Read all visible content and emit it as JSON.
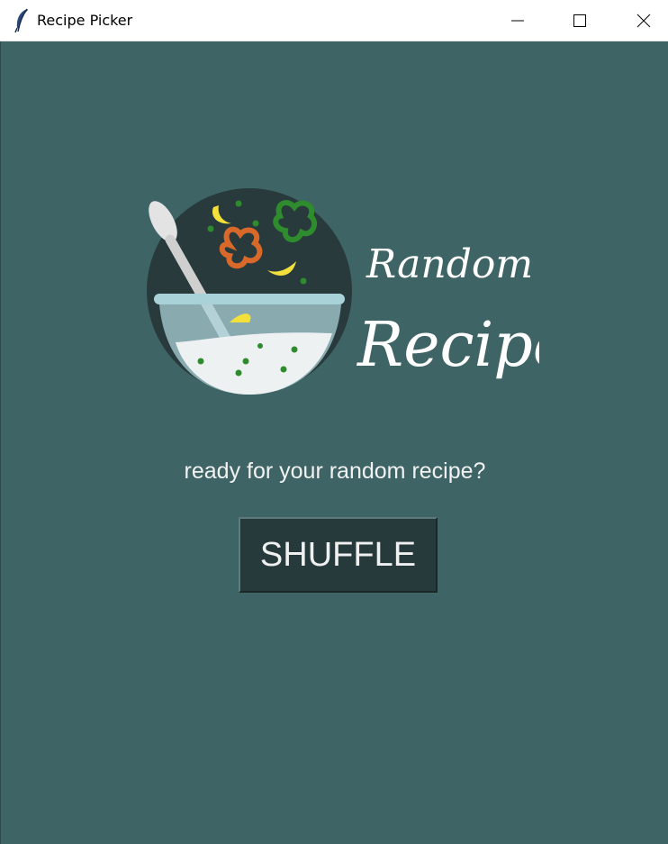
{
  "window": {
    "title": "Recipe Picker",
    "controls": {
      "minimize": "minimize-icon",
      "maximize": "maximize-icon",
      "close": "close-icon"
    }
  },
  "logo": {
    "line1": "Random",
    "line2": "Recipe"
  },
  "main": {
    "prompt": "ready for your random recipe?",
    "shuffle_label": "SHUFFLE"
  },
  "colors": {
    "background": "#3e6465",
    "button": "#263a3b",
    "text": "#f2f2f2"
  }
}
